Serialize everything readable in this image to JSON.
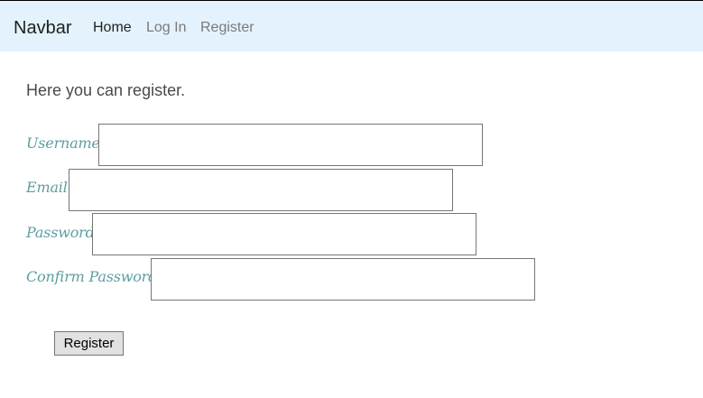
{
  "navbar": {
    "brand": "Navbar",
    "links": [
      {
        "label": "Home",
        "active": true
      },
      {
        "label": "Log In",
        "active": false
      },
      {
        "label": "Register",
        "active": false
      }
    ],
    "background": "#e3f2fd"
  },
  "page": {
    "intro": "Here you can register."
  },
  "form": {
    "username": {
      "label": "Username",
      "value": "",
      "placeholder": ""
    },
    "email": {
      "label": "Email",
      "value": "",
      "placeholder": ""
    },
    "password": {
      "label": "Password",
      "value": "",
      "placeholder": ""
    },
    "confirm_password": {
      "label": "Confirm Password",
      "value": "",
      "placeholder": ""
    },
    "submit_label": "Register",
    "label_color": "#5e9ea0"
  }
}
